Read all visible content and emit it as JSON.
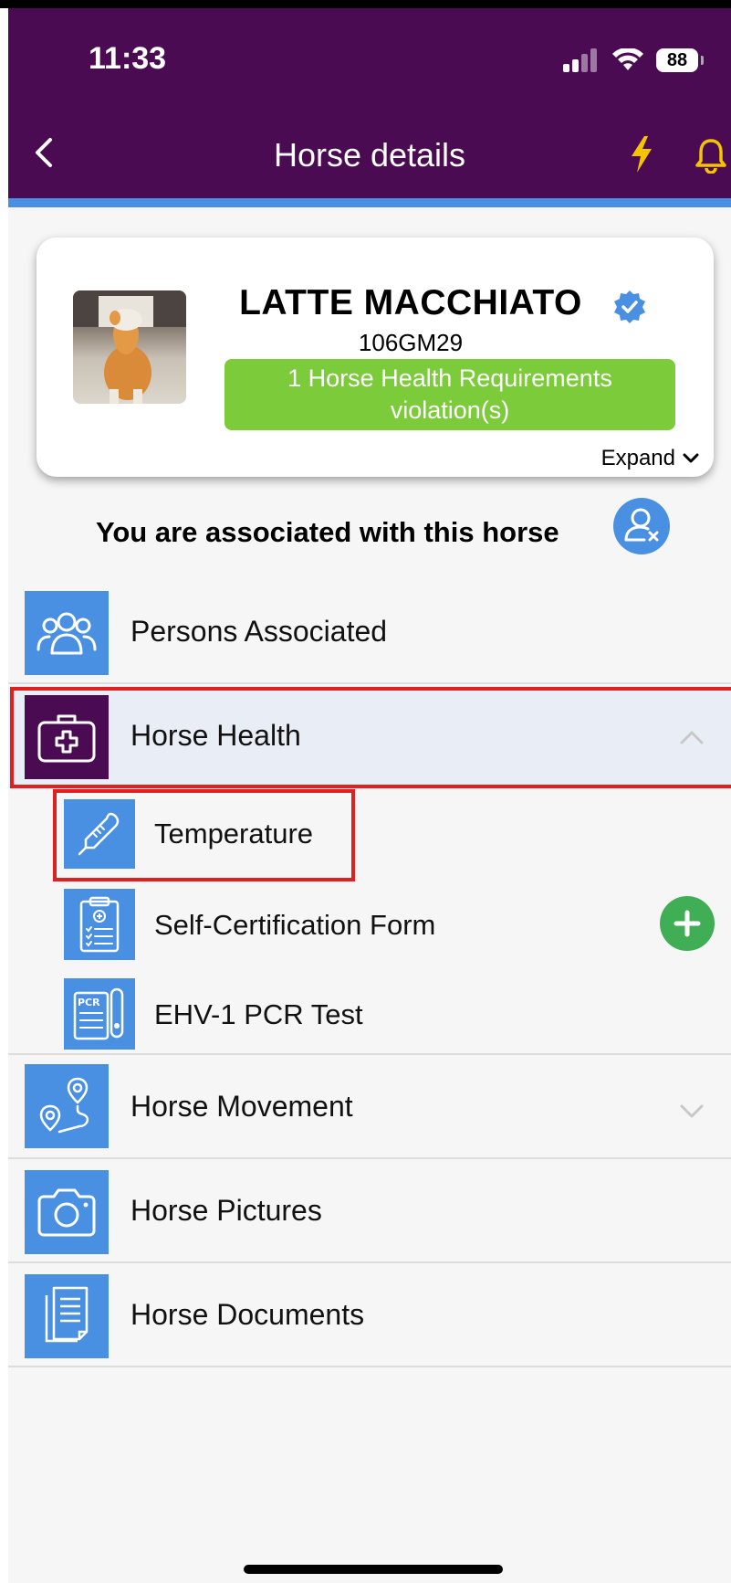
{
  "status_bar": {
    "time": "11:33",
    "battery": "88"
  },
  "header": {
    "title": "Horse details"
  },
  "horse": {
    "name": "LATTE MACCHIATO",
    "id": "106GM29",
    "violation_text": "1 Horse Health Requirements violation(s)",
    "expand_label": "Expand"
  },
  "association": {
    "text": "You are associated with this horse"
  },
  "menu": {
    "persons": "Persons Associated",
    "health": "Horse Health",
    "health_items": {
      "temperature": "Temperature",
      "self_cert": "Self-Certification Form",
      "pcr": "EHV-1 PCR Test"
    },
    "movement": "Horse Movement",
    "pictures": "Horse Pictures",
    "documents": "Horse Documents"
  },
  "colors": {
    "header_bg": "#4a0b52",
    "accent_blue": "#4a90e2",
    "violation_green": "#7ccb3b",
    "add_green": "#3fae55",
    "icon_yellow": "#f5c400",
    "highlight_red": "#e02020"
  },
  "icons": {
    "back": "chevron-left-icon",
    "bolt": "lightning-icon",
    "bell": "bell-icon",
    "verified": "verified-badge-icon",
    "unassociate": "user-remove-icon",
    "persons": "people-group-icon",
    "health": "medical-kit-icon",
    "temperature": "thermometer-icon",
    "self_cert": "clipboard-checklist-icon",
    "pcr": "pcr-test-icon",
    "movement": "route-pin-icon",
    "pictures": "camera-icon",
    "documents": "documents-icon",
    "add": "plus-icon"
  }
}
